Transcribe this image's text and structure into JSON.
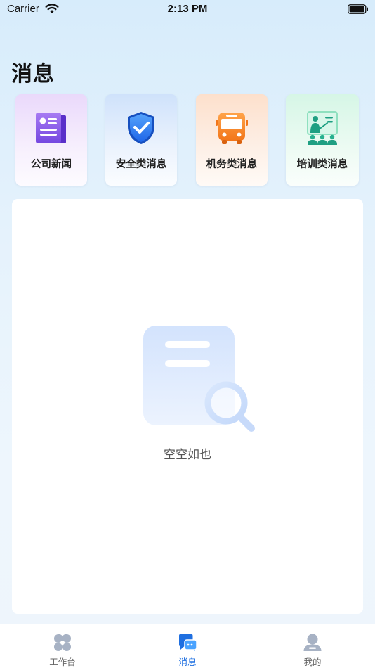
{
  "status_bar": {
    "carrier": "Carrier",
    "time": "2:13 PM",
    "icons": [
      "wifi-icon",
      "battery-icon"
    ]
  },
  "page": {
    "title": "消息"
  },
  "categories": [
    {
      "label": "公司新闻",
      "icon": "newspaper-icon",
      "color": "#7b4fe0"
    },
    {
      "label": "安全类消息",
      "icon": "shield-check-icon",
      "color": "#2f7df0"
    },
    {
      "label": "机务类消息",
      "icon": "bus-icon",
      "color": "#f7861f"
    },
    {
      "label": "培训类消息",
      "icon": "training-icon",
      "color": "#22a98a"
    }
  ],
  "empty_state": {
    "text": "空空如也",
    "icon": "empty-document-search-icon"
  },
  "tabbar": {
    "items": [
      {
        "label": "工作台",
        "icon": "workbench-icon",
        "active": false
      },
      {
        "label": "消息",
        "icon": "message-icon",
        "active": true
      },
      {
        "label": "我的",
        "icon": "profile-icon",
        "active": false
      }
    ],
    "active_color": "#1f6fe0"
  }
}
